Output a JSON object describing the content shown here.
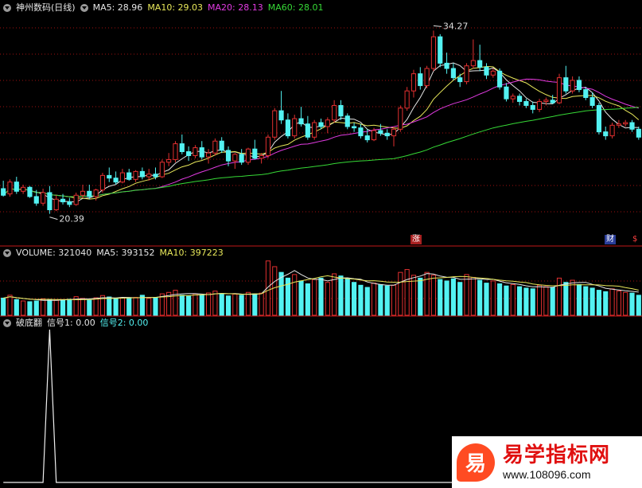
{
  "price_legend": {
    "title": "神州数码(日线)",
    "ma5": "MA5: 28.96",
    "ma10": "MA10: 29.03",
    "ma20": "MA20: 28.13",
    "ma60": "MA60: 28.01"
  },
  "volume_legend": {
    "volume": "VOLUME: 321040",
    "ma5": "MA5: 393152",
    "ma10": "MA10: 397223"
  },
  "indicator_legend": {
    "name": "破底翻",
    "signal1": "信号1: 0.00",
    "signal2": "信号2: 0.00"
  },
  "markers": {
    "rise": "涨",
    "fin": "财",
    "s": "$"
  },
  "brand": {
    "name": "易学指标网",
    "url": "www.108096.com",
    "logo_char": "易"
  },
  "colors": {
    "up": "#e23030",
    "down": "#53f2f2",
    "ma5": "#e6e6e6",
    "ma10": "#e8e85a",
    "ma20": "#e23be2",
    "ma60": "#36d936",
    "grid": "#a01010"
  },
  "chart_data": [
    {
      "type": "candlestick",
      "title": "神州数码(日线)",
      "annotations": [
        {
          "label": "34.27",
          "kind": "high",
          "value": 34.27,
          "index": 65
        },
        {
          "label": "20.39",
          "kind": "low",
          "value": 20.39,
          "index": 7
        }
      ],
      "ohlc": [
        [
          22.3,
          22.9,
          21.7,
          21.8
        ],
        [
          21.9,
          23.0,
          21.7,
          22.8
        ],
        [
          22.8,
          23.2,
          21.9,
          22.1
        ],
        [
          22.1,
          22.6,
          21.9,
          22.4
        ],
        [
          22.4,
          22.5,
          21.6,
          21.7
        ],
        [
          21.7,
          22.2,
          21.0,
          21.2
        ],
        [
          21.2,
          22.3,
          21.0,
          22.0
        ],
        [
          22.0,
          22.5,
          20.39,
          20.7
        ],
        [
          20.7,
          21.8,
          20.6,
          21.5
        ],
        [
          21.5,
          21.9,
          21.1,
          21.3
        ],
        [
          21.3,
          21.6,
          20.9,
          21.1
        ],
        [
          21.1,
          22.0,
          21.0,
          21.8
        ],
        [
          21.8,
          22.6,
          21.6,
          22.1
        ],
        [
          22.1,
          22.6,
          21.5,
          21.7
        ],
        [
          21.7,
          22.3,
          21.4,
          22.2
        ],
        [
          22.2,
          23.5,
          22.0,
          23.3
        ],
        [
          23.3,
          23.9,
          22.8,
          23.1
        ],
        [
          23.1,
          23.6,
          22.6,
          22.8
        ],
        [
          22.8,
          23.8,
          22.7,
          23.5
        ],
        [
          23.5,
          23.8,
          22.9,
          23.0
        ],
        [
          23.0,
          23.7,
          22.8,
          23.6
        ],
        [
          23.6,
          23.9,
          23.0,
          23.2
        ],
        [
          23.2,
          23.8,
          22.9,
          23.4
        ],
        [
          23.4,
          23.9,
          23.0,
          23.2
        ],
        [
          23.2,
          24.5,
          23.1,
          24.3
        ],
        [
          24.3,
          25.0,
          24.0,
          24.5
        ],
        [
          24.5,
          25.9,
          24.3,
          25.7
        ],
        [
          25.7,
          26.4,
          24.9,
          25.1
        ],
        [
          25.1,
          25.5,
          24.4,
          24.8
        ],
        [
          24.8,
          25.6,
          24.6,
          25.4
        ],
        [
          25.4,
          25.9,
          24.5,
          24.7
        ],
        [
          24.7,
          25.3,
          24.2,
          25.0
        ],
        [
          25.0,
          26.1,
          24.8,
          25.9
        ],
        [
          25.9,
          26.2,
          25.0,
          25.2
        ],
        [
          25.2,
          25.5,
          24.0,
          24.4
        ],
        [
          24.4,
          25.0,
          23.8,
          24.9
        ],
        [
          24.9,
          25.3,
          24.1,
          24.3
        ],
        [
          24.3,
          25.4,
          24.1,
          25.3
        ],
        [
          25.3,
          26.0,
          24.5,
          24.6
        ],
        [
          24.6,
          25.0,
          24.2,
          24.8
        ],
        [
          24.8,
          26.4,
          24.6,
          26.2
        ],
        [
          26.2,
          28.4,
          26.0,
          28.2
        ],
        [
          28.2,
          29.7,
          27.2,
          27.5
        ],
        [
          27.5,
          28.0,
          26.1,
          26.3
        ],
        [
          26.3,
          27.9,
          26.1,
          27.6
        ],
        [
          27.6,
          28.5,
          27.0,
          27.2
        ],
        [
          27.2,
          27.8,
          26.0,
          26.2
        ],
        [
          26.2,
          27.5,
          26.0,
          27.3
        ],
        [
          27.3,
          27.6,
          26.8,
          27.0
        ],
        [
          27.0,
          27.7,
          26.5,
          27.5
        ],
        [
          27.5,
          29.0,
          27.3,
          28.6
        ],
        [
          28.6,
          29.0,
          27.5,
          27.8
        ],
        [
          27.8,
          28.0,
          26.8,
          27.0
        ],
        [
          27.0,
          27.3,
          26.6,
          26.9
        ],
        [
          26.9,
          27.2,
          26.1,
          26.3
        ],
        [
          26.3,
          26.8,
          25.8,
          26.0
        ],
        [
          26.0,
          26.9,
          25.9,
          26.7
        ],
        [
          26.7,
          27.2,
          26.3,
          26.5
        ],
        [
          26.5,
          26.8,
          26.0,
          26.3
        ],
        [
          26.3,
          27.0,
          25.5,
          26.8
        ],
        [
          26.8,
          28.6,
          26.6,
          28.4
        ],
        [
          28.4,
          30.0,
          28.2,
          29.7
        ],
        [
          29.7,
          31.3,
          29.2,
          31.0
        ],
        [
          31.0,
          31.5,
          29.8,
          30.1
        ],
        [
          30.1,
          31.6,
          29.9,
          31.4
        ],
        [
          31.4,
          34.27,
          31.2,
          33.8
        ],
        [
          33.8,
          34.0,
          31.5,
          31.8
        ],
        [
          31.8,
          32.6,
          31.0,
          31.4
        ],
        [
          31.4,
          31.8,
          30.5,
          30.7
        ],
        [
          30.7,
          31.0,
          30.0,
          30.4
        ],
        [
          30.4,
          31.8,
          30.2,
          31.6
        ],
        [
          31.6,
          33.6,
          31.4,
          32.0
        ],
        [
          32.0,
          33.2,
          31.2,
          31.5
        ],
        [
          31.5,
          31.8,
          30.6,
          30.9
        ],
        [
          30.9,
          31.4,
          30.7,
          31.2
        ],
        [
          31.2,
          31.4,
          29.8,
          30.0
        ],
        [
          30.0,
          30.3,
          28.9,
          29.1
        ],
        [
          29.1,
          29.5,
          28.8,
          29.3
        ],
        [
          29.3,
          29.5,
          28.6,
          28.9
        ],
        [
          28.9,
          29.1,
          28.4,
          28.6
        ],
        [
          28.6,
          28.9,
          28.0,
          28.3
        ],
        [
          28.3,
          29.1,
          28.1,
          28.9
        ],
        [
          28.9,
          29.2,
          28.6,
          29.0
        ],
        [
          29.0,
          29.4,
          28.7,
          28.8
        ],
        [
          28.8,
          31.0,
          28.7,
          30.7
        ],
        [
          30.7,
          31.6,
          29.5,
          29.7
        ],
        [
          29.7,
          30.8,
          29.5,
          30.5
        ],
        [
          30.5,
          30.8,
          29.6,
          29.8
        ],
        [
          29.8,
          30.0,
          29.0,
          29.2
        ],
        [
          29.2,
          29.6,
          28.4,
          28.6
        ],
        [
          28.6,
          28.8,
          26.4,
          26.6
        ],
        [
          26.6,
          27.0,
          26.0,
          26.3
        ],
        [
          26.3,
          27.3,
          26.1,
          27.1
        ],
        [
          27.1,
          27.5,
          26.9,
          27.2
        ],
        [
          27.2,
          27.5,
          27.0,
          27.3
        ],
        [
          27.3,
          27.5,
          26.6,
          26.8
        ],
        [
          26.8,
          27.0,
          26.0,
          26.2
        ]
      ]
    },
    {
      "type": "bar",
      "title": "VOLUME",
      "values": [
        120,
        140,
        110,
        100,
        95,
        100,
        115,
        110,
        105,
        108,
        112,
        130,
        118,
        105,
        122,
        138,
        128,
        115,
        124,
        118,
        125,
        140,
        118,
        124,
        150,
        160,
        175,
        140,
        133,
        150,
        142,
        156,
        169,
        150,
        135,
        148,
        140,
        160,
        150,
        155,
        380,
        340,
        300,
        260,
        285,
        240,
        220,
        250,
        260,
        230,
        290,
        275,
        255,
        230,
        210,
        195,
        225,
        215,
        205,
        210,
        300,
        320,
        280,
        260,
        300,
        280,
        250,
        240,
        255,
        230,
        285,
        265,
        245,
        225,
        240,
        220,
        205,
        215,
        200,
        190,
        185,
        210,
        200,
        195,
        260,
        230,
        245,
        215,
        200,
        190,
        175,
        165,
        185,
        170,
        160,
        155,
        140
      ]
    },
    {
      "type": "line",
      "title": "破底翻",
      "series": [
        {
          "name": "信号1",
          "values": [
            0,
            0,
            0,
            0,
            0,
            0,
            0,
            1,
            0,
            0,
            0,
            0,
            0,
            0,
            0,
            0,
            0,
            0,
            0,
            0,
            0,
            0,
            0,
            0,
            0,
            0,
            0,
            0,
            0,
            0,
            0,
            0,
            0,
            0,
            0,
            0,
            0,
            0,
            0,
            0,
            0,
            0,
            0,
            0,
            0,
            0,
            0,
            0,
            0,
            0,
            0,
            0,
            0,
            0,
            0,
            0,
            0,
            0,
            0,
            0,
            0,
            0,
            0,
            0,
            0,
            0,
            0,
            0,
            0,
            0,
            0,
            0,
            0,
            0,
            0,
            0,
            0,
            0,
            0,
            0,
            0,
            0,
            0,
            0,
            0,
            0,
            0,
            0,
            0,
            0,
            0,
            0,
            0,
            0,
            0,
            0,
            0
          ]
        }
      ]
    }
  ]
}
